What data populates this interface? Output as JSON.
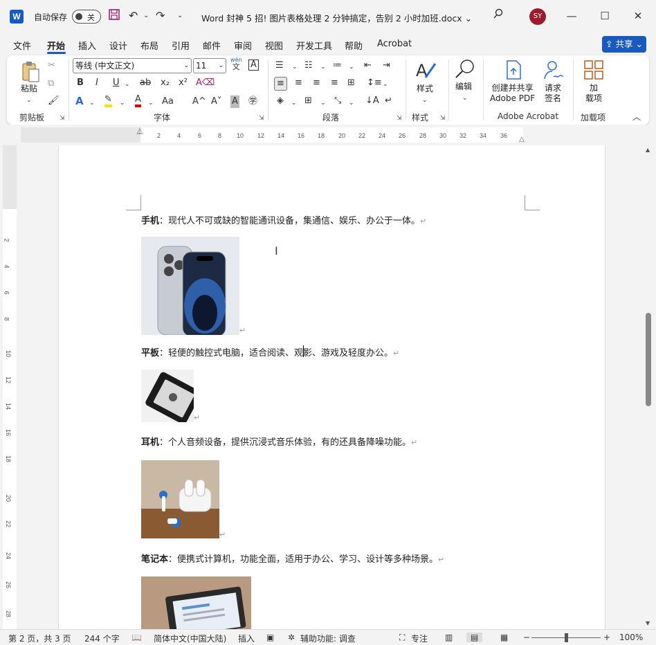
{
  "titlebar": {
    "app_logo": "W",
    "autosave_label": "自动保存",
    "autosave_state": "关",
    "doc_title": "Word 封神 5 招! 图片表格处理 2 分钟搞定，告别 2 小时加班.docx",
    "title_dropdown": "⌄",
    "avatar_initials": "SY"
  },
  "tabs": [
    "文件",
    "开始",
    "插入",
    "设计",
    "布局",
    "引用",
    "邮件",
    "审阅",
    "视图",
    "开发工具",
    "帮助",
    "Acrobat"
  ],
  "active_tab": "开始",
  "share_label": "共享",
  "ribbon": {
    "clipboard": {
      "paste": "粘贴",
      "group": "剪贴板"
    },
    "font": {
      "name": "等线 (中文正文)",
      "size": "11",
      "group": "字体",
      "bold": "B",
      "italic": "I",
      "underline": "U",
      "strike": "ab",
      "sub": "x₂",
      "sup": "x²",
      "case": "Aa",
      "grow": "A^",
      "shrink": "A˅",
      "wen": "wén",
      "wen_char": "文"
    },
    "paragraph": {
      "group": "段落"
    },
    "styles": {
      "label": "样式",
      "group": "样式"
    },
    "editing": {
      "label": "编辑"
    },
    "acrobat": {
      "create_line1": "创建并共享",
      "create_line2": "Adobe PDF",
      "sign_line1": "请求",
      "sign_line2": "签名",
      "group": "Adobe Acrobat"
    },
    "addins": {
      "line1": "加",
      "line2": "载项",
      "group": "加载项"
    }
  },
  "ruler_ticks": [
    "2",
    "4",
    "6",
    "8",
    "10",
    "12",
    "14",
    "16",
    "18",
    "20",
    "22",
    "24",
    "26",
    "28",
    "30",
    "32",
    "34",
    "36"
  ],
  "vruler_ticks": [
    "2",
    "4",
    "6",
    "8",
    "10",
    "12",
    "14",
    "16",
    "18",
    "20",
    "22",
    "24",
    "26",
    "28"
  ],
  "document": {
    "paragraphs": [
      {
        "term": "手机",
        "text": "：现代人不可或缺的智能通讯设备，集通信、娱乐、办公于一体。"
      },
      {
        "term": "平板",
        "text": "：轻便的触控式电脑，适合阅读、观影、游戏及轻度办公。"
      },
      {
        "term": "耳机",
        "text": "：个人音频设备，提供沉浸式音乐体验，有的还具备降噪功能。"
      },
      {
        "term": "笔记本",
        "text": "：便携式计算机，功能全面，适用于办公、学习、设计等多种场景。"
      }
    ],
    "para_mark": "↵"
  },
  "status": {
    "page": "第 2 页，共 3 页",
    "words": "244 个字",
    "language": "简体中文(中国大陆)",
    "insert": "插入",
    "accessibility": "辅助功能: 调查",
    "focus": "专注",
    "zoom": "100%",
    "zoom_level": 1.0
  }
}
